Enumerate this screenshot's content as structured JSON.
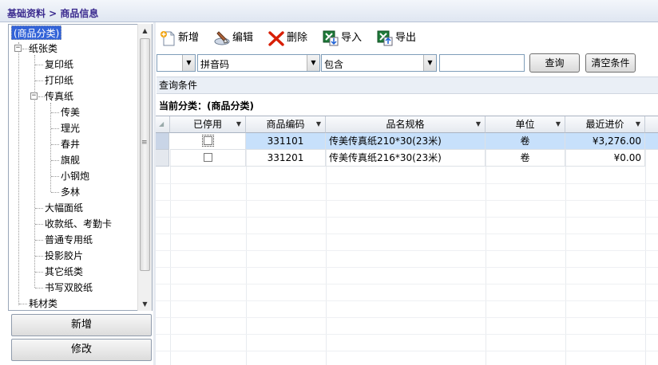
{
  "window": {
    "breadcrumb": "基础资料 > 商品信息"
  },
  "tree": {
    "root": "(商品分类)",
    "nodes": [
      {
        "label": "纸张类",
        "level": 1,
        "expanded": true
      },
      {
        "label": "复印纸",
        "level": 2
      },
      {
        "label": "打印纸",
        "level": 2
      },
      {
        "label": "传真纸",
        "level": 2,
        "expanded": true
      },
      {
        "label": "传美",
        "level": 3
      },
      {
        "label": "理光",
        "level": 3
      },
      {
        "label": "春井",
        "level": 3
      },
      {
        "label": "旗舰",
        "level": 3
      },
      {
        "label": "小钢炮",
        "level": 3
      },
      {
        "label": "多林",
        "level": 3
      },
      {
        "label": "大幅面纸",
        "level": 2
      },
      {
        "label": "收款纸、考勤卡",
        "level": 2
      },
      {
        "label": "普通专用纸",
        "level": 2
      },
      {
        "label": "投影胶片",
        "level": 2
      },
      {
        "label": "其它纸类",
        "level": 2
      },
      {
        "label": "书写双胶纸",
        "level": 2
      },
      {
        "label": "耗材类",
        "level": 1
      }
    ]
  },
  "left_buttons": {
    "add": "新增",
    "edit": "修改"
  },
  "toolbar": {
    "add": "新增",
    "edit": "编辑",
    "delete": "删除",
    "import": "导入",
    "export": "导出"
  },
  "filter": {
    "field1": "",
    "field2": "拼音码",
    "operator": "包含",
    "value": "",
    "query_button": "查询",
    "clear_button": "清空条件"
  },
  "condition_label": "查询条件",
  "current_category": "当前分类：(商品分类)",
  "grid": {
    "columns": [
      "已停用",
      "商品编码",
      "品名规格",
      "单位",
      "最近进价"
    ],
    "rows": [
      {
        "disabled": false,
        "code": "331101",
        "name": "传美传真纸210*30(23米)",
        "unit": "卷",
        "price": "¥3,276.00"
      },
      {
        "disabled": false,
        "code": "331201",
        "name": "传美传真纸216*30(23米)",
        "unit": "卷",
        "price": "¥0.00"
      }
    ]
  },
  "colors": {
    "selection": "#3363d8",
    "row_highlight": "#c7e0fb",
    "title_text": "#3b2b8f"
  }
}
